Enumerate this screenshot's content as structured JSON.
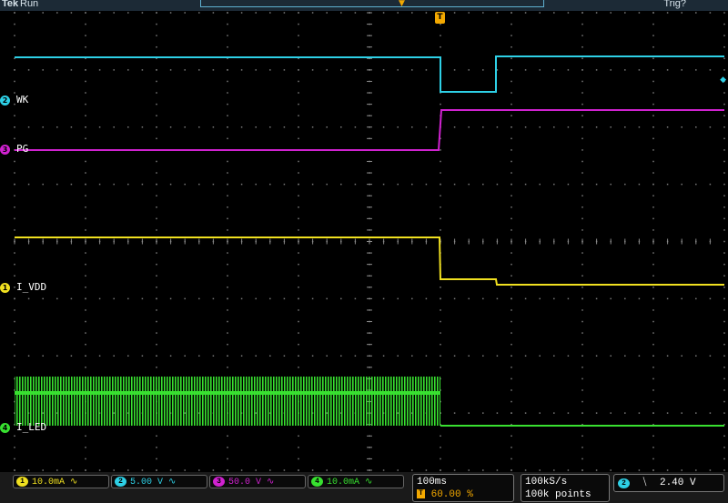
{
  "top": {
    "brand": "Tek",
    "state": "Run",
    "trigger_status": "Trig?"
  },
  "channels": [
    {
      "id": "2",
      "label": "WK",
      "color": "#2ed0e6"
    },
    {
      "id": "3",
      "label": "PG",
      "color": "#d022d0"
    },
    {
      "id": "1",
      "label": "I_VDD",
      "color": "#f0e020"
    },
    {
      "id": "4",
      "label": "I_LED",
      "color": "#38e030"
    }
  ],
  "trigger_marker": "T",
  "status": {
    "ch1": {
      "num": "1",
      "value": "10.0mA",
      "suffix": "∿",
      "color": "#f0e020"
    },
    "ch2": {
      "num": "2",
      "value": "5.00 V",
      "suffix": "∿",
      "color": "#2ed0e6"
    },
    "ch3": {
      "num": "3",
      "value": "50.0 V",
      "suffix": "∿",
      "color": "#d022d0"
    },
    "ch4": {
      "num": "4",
      "value": "10.0mA",
      "suffix": "∿",
      "color": "#38e030"
    },
    "timebase": "100ms",
    "trigger_pos": "60.00 %",
    "sample_rate": "100kS/s",
    "record_length": "100k points",
    "trigger_source": "2",
    "trigger_slope": "⧹",
    "trigger_level": "2.40 V"
  }
}
